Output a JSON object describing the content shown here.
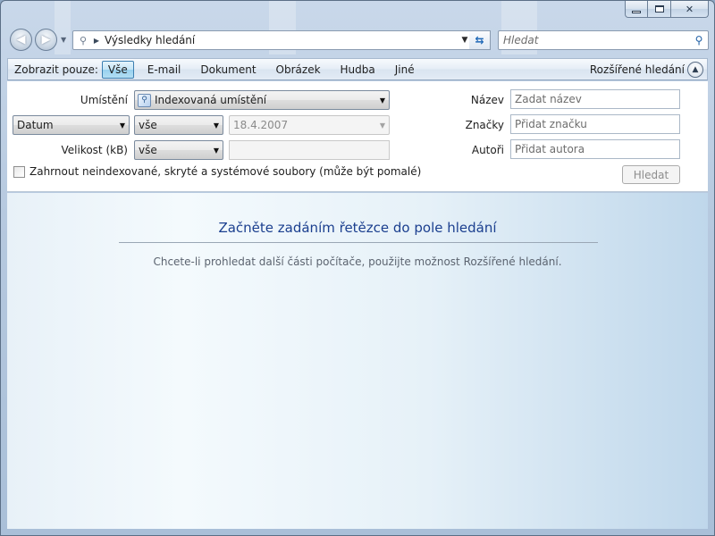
{
  "window": {
    "controls": {
      "minimize": "minimize",
      "maximize": "maximize",
      "close": "close"
    }
  },
  "nav": {
    "address_path": "Výsledky hledání",
    "search_placeholder": "Hledat"
  },
  "filter_bar": {
    "label": "Zobrazit pouze:",
    "items": [
      "Vše",
      "E-mail",
      "Dokument",
      "Obrázek",
      "Hudba",
      "Jiné"
    ],
    "active_index": 0,
    "advanced_label": "Rozšířené hledání"
  },
  "advanced": {
    "location_label": "Umístění",
    "location_value": "Indexovaná umístění",
    "date_field": "Datum",
    "date_condition": "vše",
    "date_value": "18.4.2007",
    "size_label": "Velikost (kB)",
    "size_condition": "vše",
    "size_value": "",
    "include_checkbox_label": "Zahrnout neindexované, skryté a systémové soubory (může být pomalé)",
    "include_checked": false,
    "name_label": "Název",
    "name_placeholder": "Zadat název",
    "tags_label": "Značky",
    "tags_placeholder": "Přidat značku",
    "authors_label": "Autoři",
    "authors_placeholder": "Přidat autora",
    "search_button": "Hledat"
  },
  "results": {
    "title": "Začněte zadáním řetězce do pole hledání",
    "hint": "Chcete-li prohledat další části počítače, použijte možnost Rozšířené hledání."
  }
}
